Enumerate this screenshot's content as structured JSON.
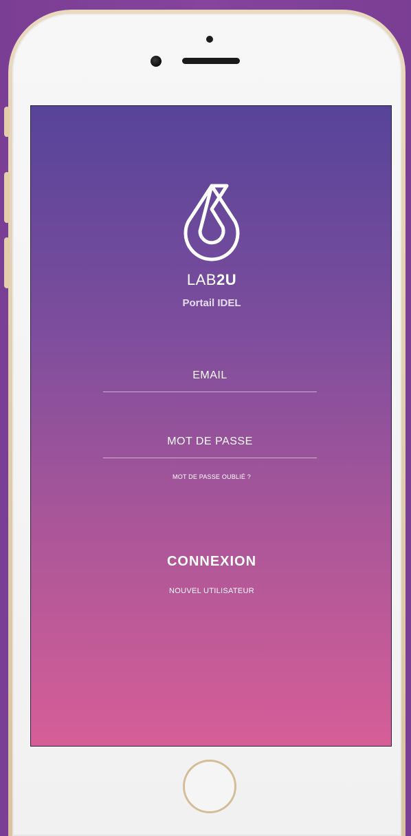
{
  "app": {
    "brand_light": "LAB",
    "brand_bold": "2U",
    "subtitle": "Portail IDEL",
    "logo_icon": "water-drop-icon"
  },
  "login": {
    "email_placeholder": "EMAIL",
    "password_placeholder": "MOT DE PASSE",
    "forgot_password": "MOT DE PASSE OUBLIÉ ?",
    "submit_label": "CONNEXION",
    "new_user_label": "NOUVEL UTILISATEUR"
  },
  "colors": {
    "gradient_top": "#574499",
    "gradient_bottom": "#d65e97",
    "text": "#ffffff",
    "phone_frame": "#e9d9bf",
    "background": "#7d3f96"
  }
}
